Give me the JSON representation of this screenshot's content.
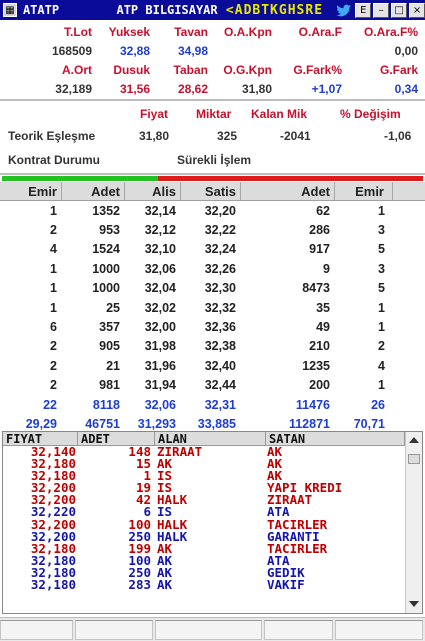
{
  "window": {
    "symbol": "ATATP",
    "title": "ATP BILGISAYAR",
    "ticker": "<ADBTKGHSRE",
    "buttons": {
      "e": "E",
      "min": "–",
      "max": "□",
      "close": "×"
    }
  },
  "stats": {
    "labels1": [
      "T.Lot",
      "Yuksek",
      "Tavan",
      "O.A.Kpn",
      "O.Ara.F",
      "O.Ara.F%"
    ],
    "values1": [
      "168509",
      "32,88",
      "34,98",
      "",
      "",
      "0,00"
    ],
    "labels2": [
      "A.Ort",
      "Dusuk",
      "Taban",
      "O.G.Kpn",
      "G.Fark%",
      "G.Fark"
    ],
    "values2": [
      "32,189",
      "31,56",
      "28,62",
      "31,80",
      "+1,07",
      "0,34"
    ]
  },
  "theoretical": {
    "headers": {
      "fiyat": "Fiyat",
      "miktar": "Miktar",
      "kalan": "Kalan Mik",
      "degisim": "% Değişim"
    },
    "label": "Teorik Eşleşme",
    "fiyat": "31,80",
    "miktar": "325",
    "kalan": "-2041",
    "degisim": "-1,06",
    "contract_label": "Kontrat Durumu",
    "contract_status": "Sürekli İşlem"
  },
  "depth_bar": {
    "bid_fraction": 0.37
  },
  "book": {
    "headers": [
      "Emir",
      "Adet",
      "Alis",
      "Satis",
      "Adet",
      "Emir"
    ],
    "rows": [
      [
        "1",
        "1352",
        "32,14",
        "32,20",
        "62",
        "1"
      ],
      [
        "2",
        "953",
        "32,12",
        "32,22",
        "286",
        "3"
      ],
      [
        "4",
        "1524",
        "32,10",
        "32,24",
        "917",
        "5"
      ],
      [
        "1",
        "1000",
        "32,06",
        "32,26",
        "9",
        "3"
      ],
      [
        "1",
        "1000",
        "32,04",
        "32,30",
        "8473",
        "5"
      ],
      [
        "1",
        "25",
        "32,02",
        "32,32",
        "35",
        "1"
      ],
      [
        "6",
        "357",
        "32,00",
        "32,36",
        "49",
        "1"
      ],
      [
        "2",
        "905",
        "31,98",
        "32,38",
        "210",
        "2"
      ],
      [
        "2",
        "21",
        "31,96",
        "32,40",
        "1235",
        "4"
      ],
      [
        "2",
        "981",
        "31,94",
        "32,44",
        "200",
        "1"
      ]
    ],
    "totals": [
      [
        "22",
        "8118",
        "32,06",
        "32,31",
        "11476",
        "26"
      ],
      [
        "29,29",
        "46751",
        "31,293",
        "33,885",
        "112871",
        "70,71"
      ]
    ]
  },
  "trades": {
    "headers": [
      "FIYAT",
      "ADET",
      "ALAN",
      "SATAN"
    ],
    "rows": [
      {
        "fiyat": "32,140",
        "adet": "148",
        "alan": "ZIRAAT",
        "satan": "AK",
        "side": "sell"
      },
      {
        "fiyat": "32,180",
        "adet": "15",
        "alan": "AK",
        "satan": "AK",
        "side": "sell"
      },
      {
        "fiyat": "32,180",
        "adet": "1",
        "alan": "IS",
        "satan": "AK",
        "side": "sell"
      },
      {
        "fiyat": "32,200",
        "adet": "19",
        "alan": "IS",
        "satan": "YAPI KREDI",
        "side": "sell"
      },
      {
        "fiyat": "32,200",
        "adet": "42",
        "alan": "HALK",
        "satan": "ZIRAAT",
        "side": "sell"
      },
      {
        "fiyat": "32,220",
        "adet": "6",
        "alan": "IS",
        "satan": "ATA",
        "side": "buy"
      },
      {
        "fiyat": "32,200",
        "adet": "100",
        "alan": "HALK",
        "satan": "TACIRLER",
        "side": "sell"
      },
      {
        "fiyat": "32,200",
        "adet": "250",
        "alan": "HALK",
        "satan": "GARANTI",
        "side": "buy"
      },
      {
        "fiyat": "32,180",
        "adet": "199",
        "alan": "AK",
        "satan": "TACIRLER",
        "side": "sell"
      },
      {
        "fiyat": "32,180",
        "adet": "100",
        "alan": "AK",
        "satan": "ATA",
        "side": "buy"
      },
      {
        "fiyat": "32,180",
        "adet": "250",
        "alan": "AK",
        "satan": "GEDIK",
        "side": "buy"
      },
      {
        "fiyat": "32,180",
        "adet": "283",
        "alan": "AK",
        "satan": "VAKIF",
        "side": "buy"
      }
    ]
  },
  "colors": {
    "titlebar": "#0b0b9a",
    "label_red": "#c8102e",
    "value_blue": "#1e3cd8",
    "sell_red": "#c00000",
    "buy_blue": "#1414b0"
  }
}
